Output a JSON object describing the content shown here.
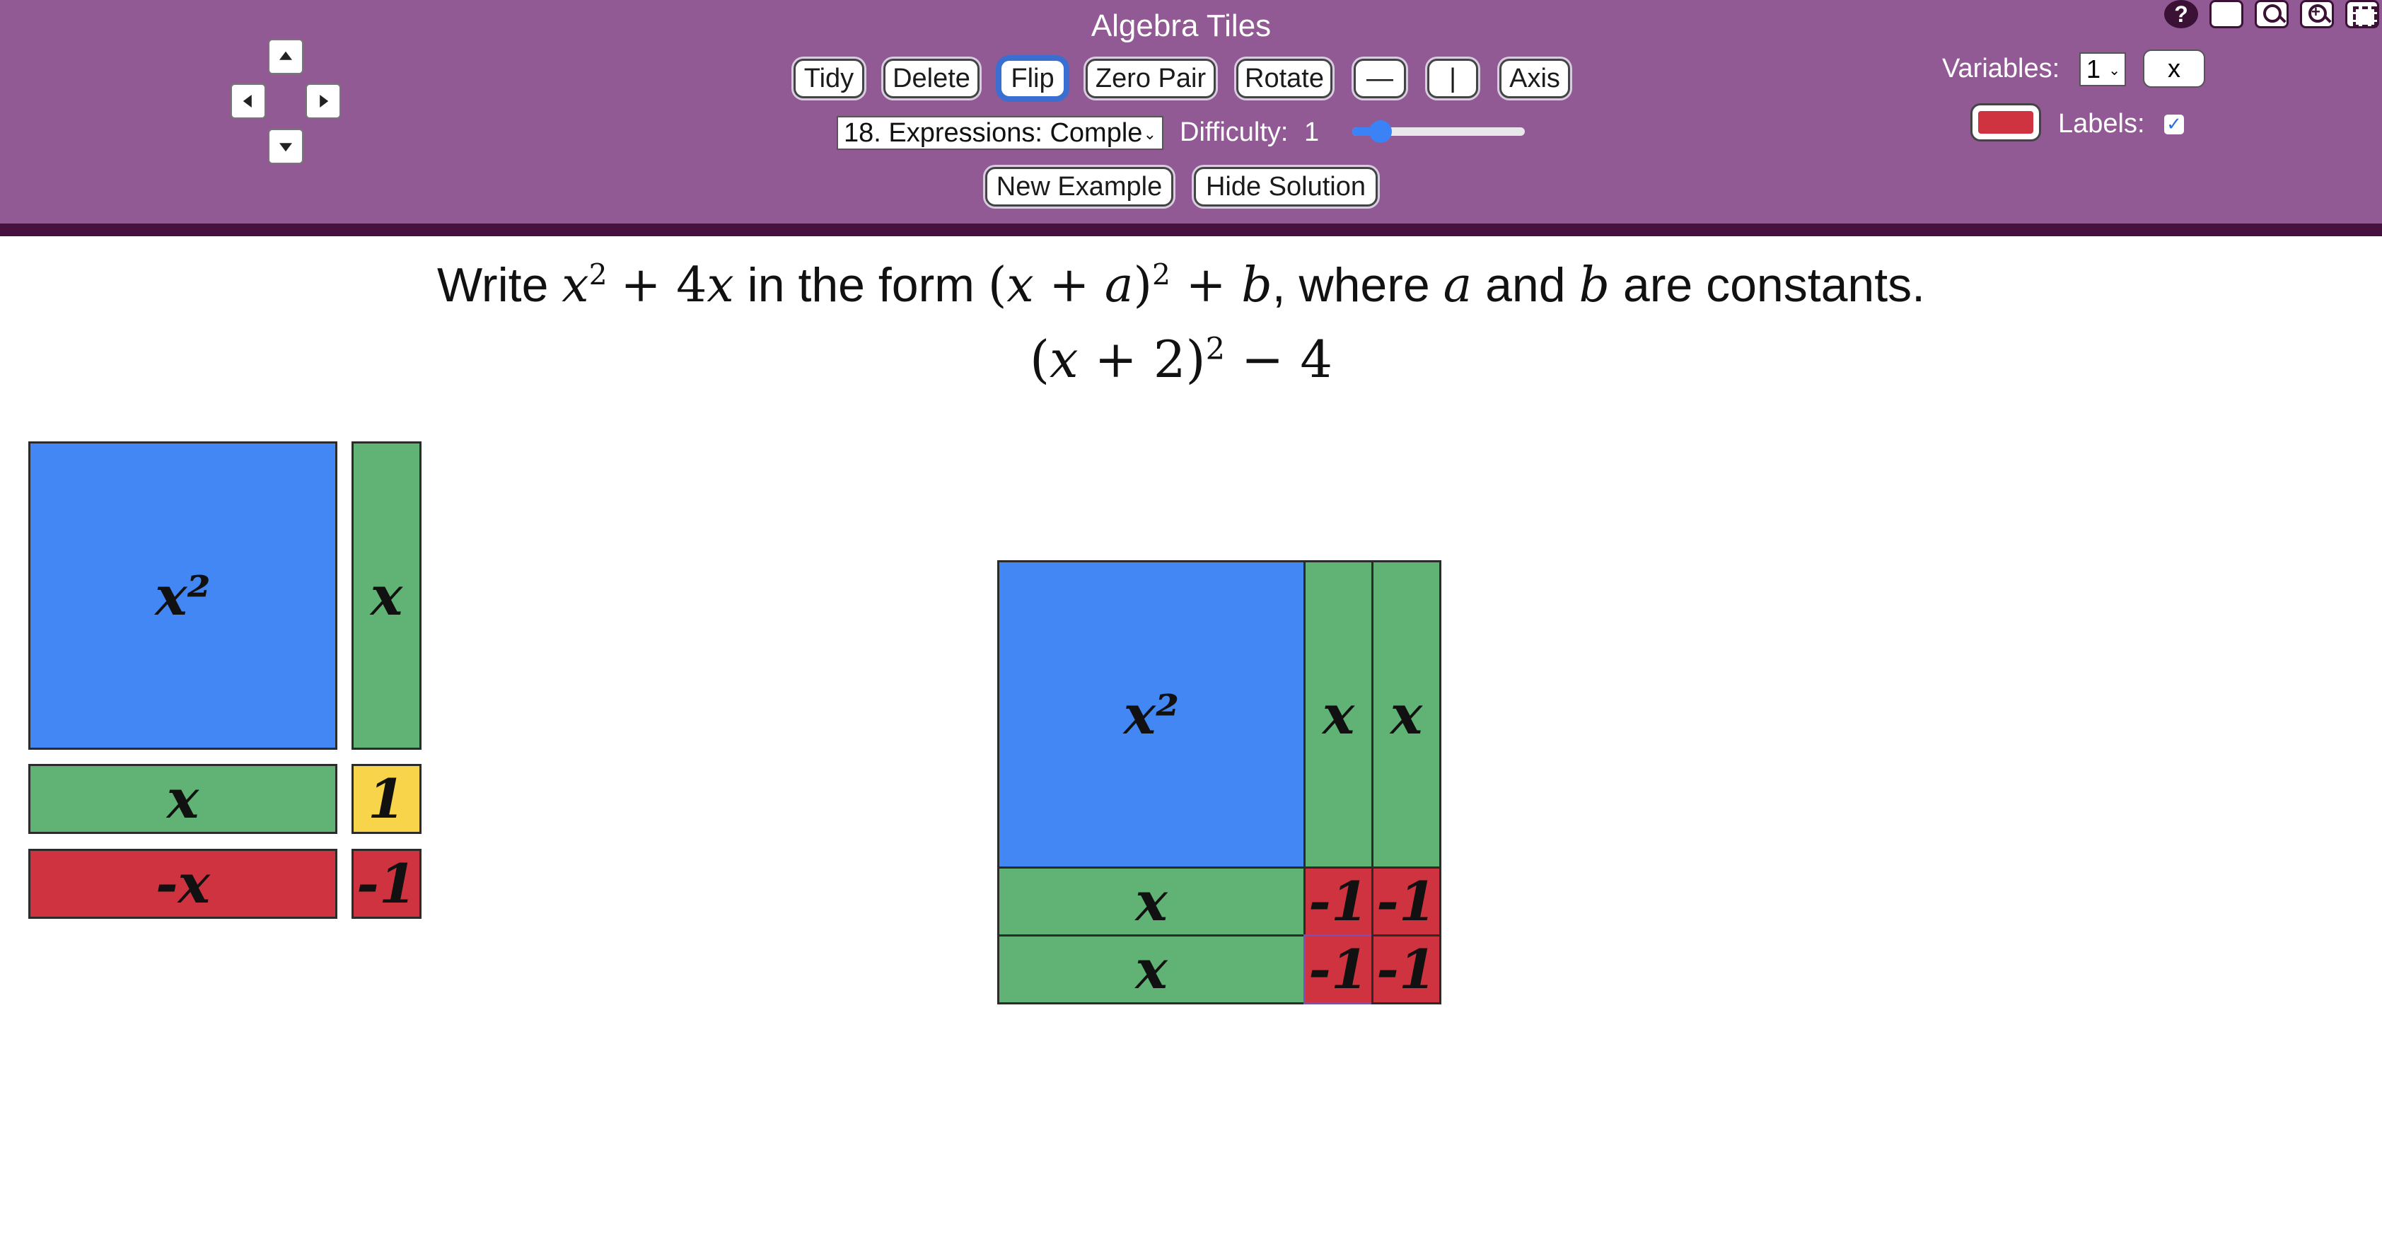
{
  "app": {
    "title": "Algebra Tiles"
  },
  "nav": {
    "up": "",
    "down": "",
    "left": "",
    "right": ""
  },
  "toolbar": {
    "buttons": [
      "Tidy",
      "Delete",
      "Flip",
      "Zero Pair",
      "Rotate",
      "—",
      "|",
      "Axis"
    ],
    "focused_button": "Flip",
    "select_value": "18. Expressions: Comple",
    "difficulty_label": "Difficulty:",
    "difficulty_value": "1",
    "difficulty_fraction": 0.1,
    "new_example": "New Example",
    "hide_solution": "Hide Solution"
  },
  "settings": {
    "variables_label": "Variables:",
    "variables_value": "1",
    "variable_name": "x",
    "labels_label": "Labels:",
    "labels_checked": "✓",
    "tile_color": "#cf3340"
  },
  "icons": {
    "help": "?",
    "help_name": "help-icon",
    "blank_name": "blank-page-icon",
    "zoom_out_name": "zoom-out-icon",
    "zoom_in_name": "zoom-in-icon",
    "fullscreen_name": "fullscreen-icon"
  },
  "problem": {
    "write": "Write",
    "expr_var": "x",
    "expr_exp": "2",
    "expr_rest": "+ 4",
    "expr_var2": "x",
    "in_the_form": "in the form",
    "form_open": "(",
    "form_var": "x",
    "form_plus": " + ",
    "form_a": "a",
    "form_close": ")",
    "form_exp": "2",
    "form_plus_b": " + ",
    "form_b": "b",
    "where": ", where",
    "a": "a",
    "and": "and",
    "b": "b",
    "are_constants": "are constants."
  },
  "solution": {
    "open": "(",
    "var": "x",
    "plus": " + 2)",
    "exp": "2",
    "minus": " − 4"
  },
  "palette": {
    "x2": "x²",
    "x_vertical": "x",
    "x_horizontal": "x",
    "one": "1",
    "neg_x": "-x",
    "neg_one": "-1"
  },
  "workspace": {
    "x2": "x²",
    "x_col_1": "x",
    "x_col_2": "x",
    "x_row_1": "x",
    "x_row_2": "x",
    "neg_ones": [
      "-1",
      "-1",
      "-1",
      "-1"
    ]
  },
  "colors": {
    "toolbar": "#915a94",
    "x2_tile": "#4387f5",
    "x_tile": "#60b275",
    "unit_tile": "#f7d449",
    "negative_tile": "#cf3340"
  }
}
